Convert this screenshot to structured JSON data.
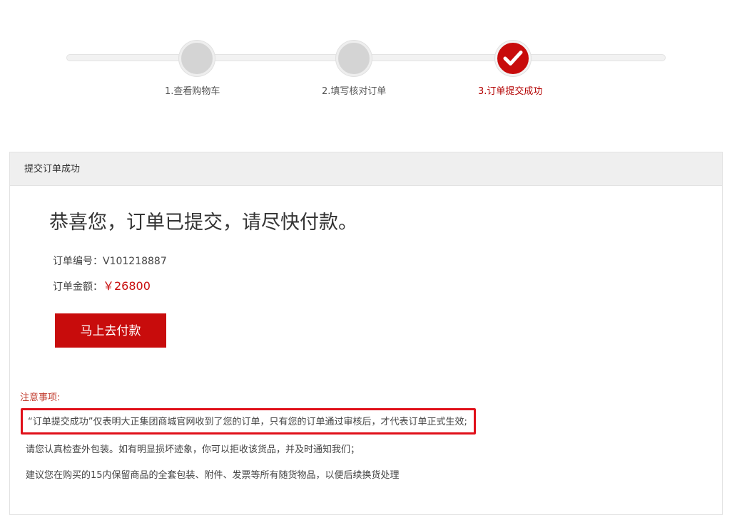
{
  "steps": [
    {
      "label": "1.查看购物车",
      "state": "pending"
    },
    {
      "label": "2.填写核对订单",
      "state": "pending"
    },
    {
      "label": "3.订单提交成功",
      "state": "done"
    }
  ],
  "panel": {
    "header": "提交订单成功",
    "headline": "恭喜您，订单已提交，请尽快付款。",
    "order_no_label": "订单编号：",
    "order_no_value": "V101218887",
    "amount_label": "订单金额：",
    "amount_value": "￥26800",
    "pay_button": "马上去付款"
  },
  "notes": {
    "title": "注意事项:",
    "items": [
      "“订单提交成功”仅表明大正集团商城官网收到了您的订单，只有您的订单通过审核后，才代表订单正式生效;",
      "请您认真检查外包装。如有明显损坏迹象，你可以拒收该货品，并及时通知我们；",
      "建议您在购买的15内保留商品的全套包装、附件、发票等所有随货物品，以便后续换货处理"
    ]
  },
  "colors": {
    "accent": "#c80c0c",
    "step_pending": "#d4d4d4",
    "highlight_border": "#e0101a"
  },
  "icons": {
    "step3": "check-icon"
  }
}
